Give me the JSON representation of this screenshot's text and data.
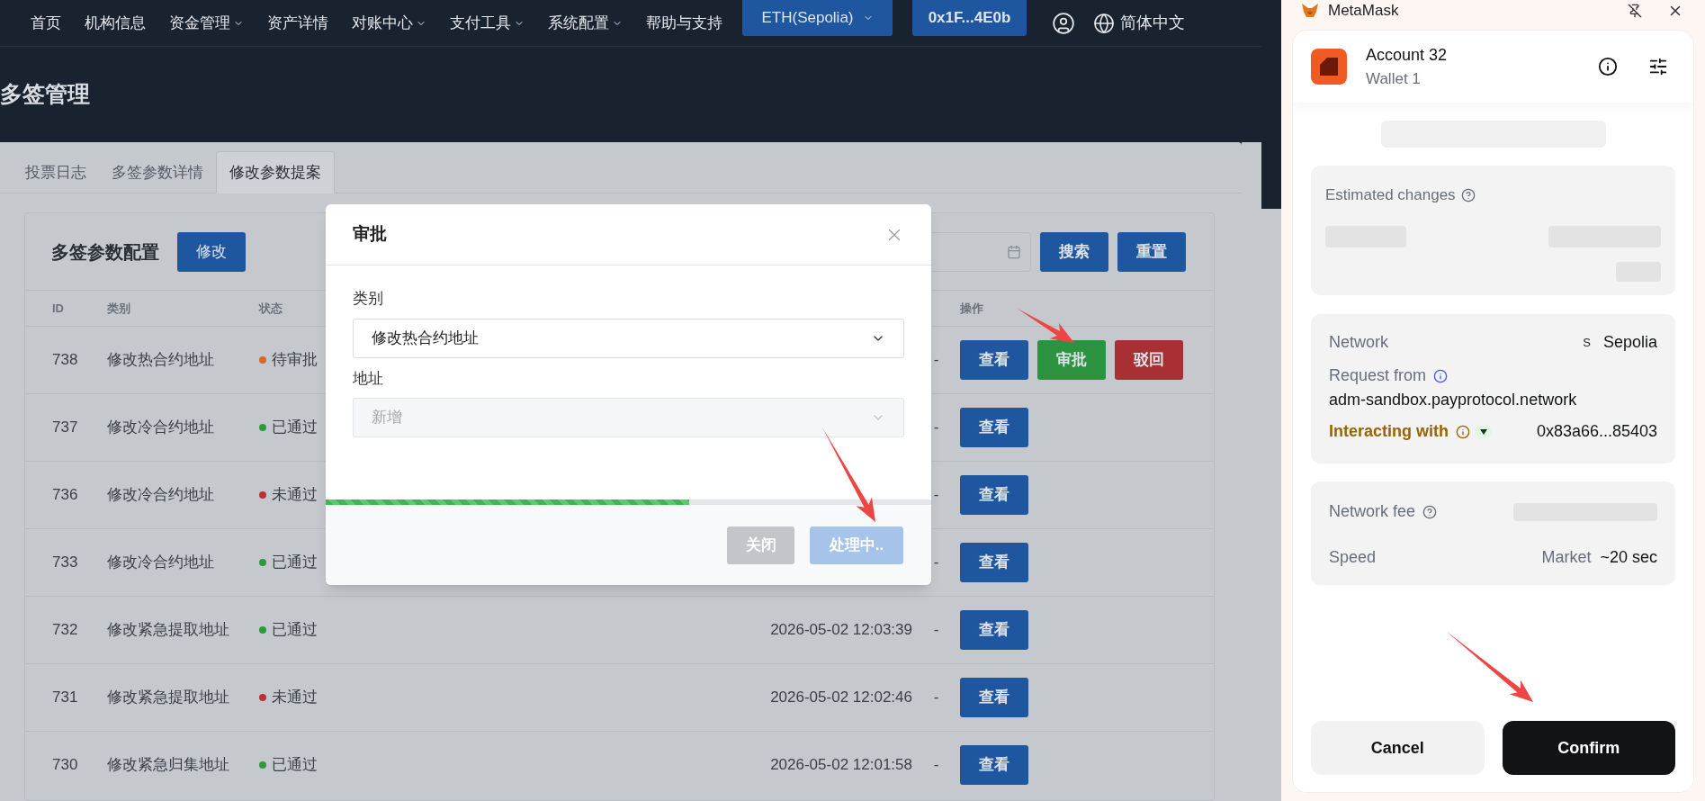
{
  "nav": {
    "items": [
      {
        "label": "首页",
        "has_menu": false
      },
      {
        "label": "机构信息",
        "has_menu": false
      },
      {
        "label": "资金管理",
        "has_menu": true
      },
      {
        "label": "资产详情",
        "has_menu": false
      },
      {
        "label": "对账中心",
        "has_menu": true
      },
      {
        "label": "支付工具",
        "has_menu": true
      },
      {
        "label": "系统配置",
        "has_menu": true
      },
      {
        "label": "帮助与支持",
        "has_menu": false
      }
    ],
    "network_button": "ETH(Sepolia)",
    "address_button": "0x1F...4E0b",
    "language": "简体中文"
  },
  "page_title": "多签管理",
  "tabs": [
    {
      "label": "投票日志",
      "selected": false
    },
    {
      "label": "多签参数详情",
      "selected": false
    },
    {
      "label": "修改参数提案",
      "selected": true
    }
  ],
  "card": {
    "title": "多签参数配置",
    "edit_button": "修改",
    "search_button": "搜索",
    "reset_button": "重置",
    "columns": {
      "id": "ID",
      "category": "类别",
      "status": "状态",
      "actions": "操作"
    },
    "rows": [
      {
        "id": "738",
        "category": "修改热合约地址",
        "status": "待审批",
        "color": "#d9672a",
        "dash": "-",
        "actions": [
          {
            "label": "查看",
            "kind": "view"
          },
          {
            "label": "审批",
            "kind": "approve"
          },
          {
            "label": "驳回",
            "kind": "reject"
          }
        ]
      },
      {
        "id": "737",
        "category": "修改冷合约地址",
        "status": "已通过",
        "color": "#2e9a3e",
        "dash": "-",
        "actions": [
          {
            "label": "查看",
            "kind": "view"
          }
        ]
      },
      {
        "id": "736",
        "category": "修改冷合约地址",
        "status": "未通过",
        "color": "#b8323a",
        "dash": "-",
        "actions": [
          {
            "label": "查看",
            "kind": "view"
          }
        ]
      },
      {
        "id": "733",
        "category": "修改冷合约地址",
        "status": "已通过",
        "color": "#2e9a3e",
        "dash": "-",
        "actions": [
          {
            "label": "查看",
            "kind": "view"
          }
        ]
      },
      {
        "id": "732",
        "category": "修改紧急提取地址",
        "status": "已通过",
        "color": "#2e9a3e",
        "time": "2026-05-02 12:03:39",
        "dash": "-",
        "actions": [
          {
            "label": "查看",
            "kind": "view"
          }
        ]
      },
      {
        "id": "731",
        "category": "修改紧急提取地址",
        "status": "未通过",
        "color": "#b8323a",
        "time": "2026-05-02 12:02:46",
        "dash": "-",
        "actions": [
          {
            "label": "查看",
            "kind": "view"
          }
        ]
      },
      {
        "id": "730",
        "category": "修改紧急归集地址",
        "status": "已通过",
        "color": "#2e9a3e",
        "time": "2026-05-02 12:01:58",
        "dash": "-",
        "actions": [
          {
            "label": "查看",
            "kind": "view"
          }
        ]
      }
    ]
  },
  "modal": {
    "title": "审批",
    "fields": [
      {
        "label": "类别",
        "value": "修改热合约地址",
        "disabled": false
      },
      {
        "label": "地址",
        "value": "新增",
        "disabled": true
      }
    ],
    "progress": {
      "level": 0.6
    },
    "buttons": [
      {
        "label": "关闭",
        "kind": "close"
      },
      {
        "label": "处理中..",
        "kind": "processing"
      }
    ]
  },
  "metamask": {
    "app_name": "MetaMask",
    "account": "Account 32",
    "wallet": "Wallet 1",
    "estimated_changes": "Estimated changes",
    "network_label": "Network",
    "network_badge": "S",
    "network": "Sepolia",
    "request_from_label": "Request from",
    "request_from": "adm-sandbox.payprotocol.network",
    "interacting_label": "Interacting with",
    "contract": "0x83a66...85403",
    "fee_label": "Network fee",
    "speed_label": "Speed",
    "speed": "Market",
    "speed_time": "~20 sec",
    "cancel": "Cancel",
    "confirm": "Confirm"
  }
}
